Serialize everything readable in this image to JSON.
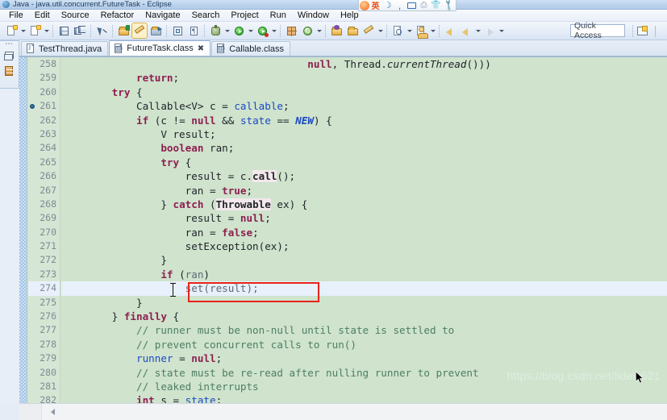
{
  "window": {
    "title": "Java - java.util.concurrent.FutureTask - Eclipse",
    "app_icon": "eclipse-icon"
  },
  "menubar": {
    "items": [
      {
        "label": "File"
      },
      {
        "label": "Edit"
      },
      {
        "label": "Source"
      },
      {
        "label": "Refactor"
      },
      {
        "label": "Navigate"
      },
      {
        "label": "Search"
      },
      {
        "label": "Project"
      },
      {
        "label": "Run"
      },
      {
        "label": "Window"
      },
      {
        "label": "Help"
      }
    ]
  },
  "toolbar": {
    "buttons": [
      {
        "name": "new-wizard-icon",
        "has_dropdown": true
      },
      {
        "name": "new-java-project-icon",
        "has_dropdown": true
      },
      {
        "name": "save-icon",
        "has_dropdown": false
      },
      {
        "name": "save-all-icon",
        "has_dropdown": false
      },
      {
        "name": "toggle-mark-occurrences-icon",
        "has_dropdown": false
      },
      {
        "name": "new-java-package-icon",
        "has_dropdown": false
      },
      {
        "name": "toggle-breadcrumb-icon",
        "has_dropdown": false,
        "pressed": true
      },
      {
        "name": "link-with-editor-icon",
        "has_dropdown": false
      },
      {
        "name": "open-type-icon",
        "has_dropdown": false
      },
      {
        "name": "show-whitespace-icon",
        "has_dropdown": false
      },
      {
        "name": "debug-icon",
        "has_dropdown": true
      },
      {
        "name": "run-icon",
        "has_dropdown": true
      },
      {
        "name": "run-coverage-icon",
        "has_dropdown": true
      },
      {
        "name": "new-junit-test-icon",
        "has_dropdown": false
      },
      {
        "name": "external-tools-icon",
        "has_dropdown": true
      },
      {
        "name": "open-task-icon",
        "has_dropdown": false
      },
      {
        "name": "open-folder-icon",
        "has_dropdown": false
      },
      {
        "name": "pencil-icon",
        "has_dropdown": true
      },
      {
        "name": "search-icon",
        "has_dropdown": true
      },
      {
        "name": "open-type-hierarchy-icon",
        "has_dropdown": true
      },
      {
        "name": "previous-edit-location-icon",
        "has_dropdown": false
      },
      {
        "name": "back-icon",
        "has_dropdown": true
      },
      {
        "name": "forward-icon",
        "has_dropdown": true
      }
    ],
    "quick_access_placeholder": "Quick Access",
    "perspective_button": "open-perspective-icon"
  },
  "ime_bar": {
    "items": [
      {
        "name": "sogou-logo-icon"
      },
      {
        "name": "language-mode-label",
        "label": "英"
      },
      {
        "name": "moon-icon",
        "label": "☽"
      },
      {
        "name": "punctuation-icon",
        "label": ","
      },
      {
        "name": "soft-keyboard-icon"
      },
      {
        "name": "printer-icon"
      },
      {
        "name": "skin-icon"
      },
      {
        "name": "toolbox-icon"
      }
    ]
  },
  "view_stack": {
    "items": [
      {
        "name": "restore-icon"
      },
      {
        "name": "outline-view-icon"
      }
    ]
  },
  "editor_tabs": [
    {
      "label": "TestThread.java",
      "icon": "java-file-icon",
      "active": false,
      "closable": false
    },
    {
      "label": "FutureTask.class",
      "icon": "class-file-icon",
      "active": true,
      "closable": true
    },
    {
      "label": "Callable.class",
      "icon": "class-file-icon",
      "active": false,
      "closable": false
    }
  ],
  "editor": {
    "background_color": "#cfe3cd",
    "highlight_line_color": "#e8f0fb",
    "annotation_box_color": "#e8231a",
    "lines": [
      {
        "number": "258",
        "breakpoint": false,
        "highlight": false,
        "tokens": [
          {
            "t": "                                        ",
            "c": "id"
          },
          {
            "t": "null",
            "c": "kw"
          },
          {
            "t": ", Thread.",
            "c": "id"
          },
          {
            "t": "currentThread",
            "c": "itl"
          },
          {
            "t": "()))",
            "c": "id"
          }
        ]
      },
      {
        "number": "259",
        "breakpoint": false,
        "highlight": false,
        "tokens": [
          {
            "t": "            ",
            "c": "id"
          },
          {
            "t": "return",
            "c": "kw"
          },
          {
            "t": ";",
            "c": "id"
          }
        ]
      },
      {
        "number": "260",
        "breakpoint": false,
        "highlight": false,
        "tokens": [
          {
            "t": "        ",
            "c": "id"
          },
          {
            "t": "try",
            "c": "kw"
          },
          {
            "t": " {",
            "c": "id"
          }
        ]
      },
      {
        "number": "261",
        "breakpoint": true,
        "highlight": false,
        "tokens": [
          {
            "t": "            ",
            "c": "id"
          },
          {
            "t": "Callable<V>",
            "c": "id"
          },
          {
            "t": " c = ",
            "c": "id"
          },
          {
            "t": "callable",
            "c": "fld"
          },
          {
            "t": ";",
            "c": "id"
          }
        ]
      },
      {
        "number": "262",
        "breakpoint": false,
        "highlight": false,
        "tokens": [
          {
            "t": "            ",
            "c": "id"
          },
          {
            "t": "if",
            "c": "kw"
          },
          {
            "t": " (c != ",
            "c": "id"
          },
          {
            "t": "null",
            "c": "kw"
          },
          {
            "t": " && ",
            "c": "id"
          },
          {
            "t": "state",
            "c": "fld"
          },
          {
            "t": " == ",
            "c": "id"
          },
          {
            "t": "NEW",
            "c": "sfld"
          },
          {
            "t": ") {",
            "c": "id"
          }
        ]
      },
      {
        "number": "263",
        "breakpoint": false,
        "highlight": false,
        "tokens": [
          {
            "t": "                V result;",
            "c": "id"
          }
        ]
      },
      {
        "number": "264",
        "breakpoint": false,
        "highlight": false,
        "tokens": [
          {
            "t": "                ",
            "c": "id"
          },
          {
            "t": "boolean",
            "c": "kw"
          },
          {
            "t": " ran;",
            "c": "id"
          }
        ]
      },
      {
        "number": "265",
        "breakpoint": false,
        "highlight": false,
        "tokens": [
          {
            "t": "                ",
            "c": "id"
          },
          {
            "t": "try",
            "c": "kw"
          },
          {
            "t": " {",
            "c": "id"
          }
        ]
      },
      {
        "number": "266",
        "breakpoint": false,
        "highlight": false,
        "tokens": [
          {
            "t": "                    result = c.",
            "c": "id"
          },
          {
            "t": "call",
            "c": "mcall"
          },
          {
            "t": "();",
            "c": "id"
          }
        ]
      },
      {
        "number": "267",
        "breakpoint": false,
        "highlight": false,
        "tokens": [
          {
            "t": "                    ran = ",
            "c": "id"
          },
          {
            "t": "true",
            "c": "kw"
          },
          {
            "t": ";",
            "c": "id"
          }
        ]
      },
      {
        "number": "268",
        "breakpoint": false,
        "highlight": false,
        "tokens": [
          {
            "t": "                } ",
            "c": "id"
          },
          {
            "t": "catch",
            "c": "kw"
          },
          {
            "t": " (",
            "c": "id"
          },
          {
            "t": "Throwable",
            "c": "mcall"
          },
          {
            "t": " ex) {",
            "c": "id"
          }
        ]
      },
      {
        "number": "269",
        "breakpoint": false,
        "highlight": false,
        "tokens": [
          {
            "t": "                    result = ",
            "c": "id"
          },
          {
            "t": "null",
            "c": "kw"
          },
          {
            "t": ";",
            "c": "id"
          }
        ]
      },
      {
        "number": "270",
        "breakpoint": false,
        "highlight": false,
        "tokens": [
          {
            "t": "                    ran = ",
            "c": "id"
          },
          {
            "t": "false",
            "c": "kw"
          },
          {
            "t": ";",
            "c": "id"
          }
        ]
      },
      {
        "number": "271",
        "breakpoint": false,
        "highlight": false,
        "tokens": [
          {
            "t": "                    setException(ex);",
            "c": "id"
          }
        ]
      },
      {
        "number": "272",
        "breakpoint": false,
        "highlight": false,
        "tokens": [
          {
            "t": "                }",
            "c": "id"
          }
        ]
      },
      {
        "number": "273",
        "breakpoint": false,
        "highlight": false,
        "tokens": [
          {
            "t": "                ",
            "c": "id"
          },
          {
            "t": "if",
            "c": "kw"
          },
          {
            "t": " (",
            "c": "id"
          },
          {
            "t": "ran",
            "c": "dim"
          },
          {
            "t": ")",
            "c": "id"
          }
        ]
      },
      {
        "number": "274",
        "breakpoint": false,
        "highlight": true,
        "tokens": [
          {
            "t": "                    set(",
            "c": "dim"
          },
          {
            "t": "result",
            "c": "dim"
          },
          {
            "t": ");",
            "c": "dim"
          }
        ]
      },
      {
        "number": "275",
        "breakpoint": false,
        "highlight": false,
        "tokens": [
          {
            "t": "            }",
            "c": "id"
          }
        ]
      },
      {
        "number": "276",
        "breakpoint": false,
        "highlight": false,
        "tokens": [
          {
            "t": "        } ",
            "c": "id"
          },
          {
            "t": "finally",
            "c": "kw"
          },
          {
            "t": " {",
            "c": "id"
          }
        ]
      },
      {
        "number": "277",
        "breakpoint": false,
        "highlight": false,
        "tokens": [
          {
            "t": "            ",
            "c": "id"
          },
          {
            "t": "// runner must be non-null until state is settled to",
            "c": "cmt"
          }
        ]
      },
      {
        "number": "278",
        "breakpoint": false,
        "highlight": false,
        "tokens": [
          {
            "t": "            ",
            "c": "id"
          },
          {
            "t": "// prevent concurrent calls to run()",
            "c": "cmt"
          }
        ]
      },
      {
        "number": "279",
        "breakpoint": false,
        "highlight": false,
        "tokens": [
          {
            "t": "            ",
            "c": "id"
          },
          {
            "t": "runner",
            "c": "fld"
          },
          {
            "t": " = ",
            "c": "id"
          },
          {
            "t": "null",
            "c": "kw"
          },
          {
            "t": ";",
            "c": "id"
          }
        ]
      },
      {
        "number": "280",
        "breakpoint": false,
        "highlight": false,
        "tokens": [
          {
            "t": "            ",
            "c": "id"
          },
          {
            "t": "// state must be re-read after nulling runner to prevent",
            "c": "cmt"
          }
        ]
      },
      {
        "number": "281",
        "breakpoint": false,
        "highlight": false,
        "tokens": [
          {
            "t": "            ",
            "c": "id"
          },
          {
            "t": "// leaked interrupts",
            "c": "cmt"
          }
        ]
      },
      {
        "number": "282",
        "breakpoint": false,
        "highlight": false,
        "tokens": [
          {
            "t": "            ",
            "c": "id"
          },
          {
            "t": "int",
            "c": "kw"
          },
          {
            "t": " s = ",
            "c": "id"
          },
          {
            "t": "state",
            "c": "fld"
          },
          {
            "t": ";",
            "c": "id"
          }
        ]
      }
    ]
  },
  "watermark": {
    "text": "https://blog.csdn.net/lidew521"
  },
  "scrollbar": {
    "name": "horizontal-scrollbar"
  }
}
